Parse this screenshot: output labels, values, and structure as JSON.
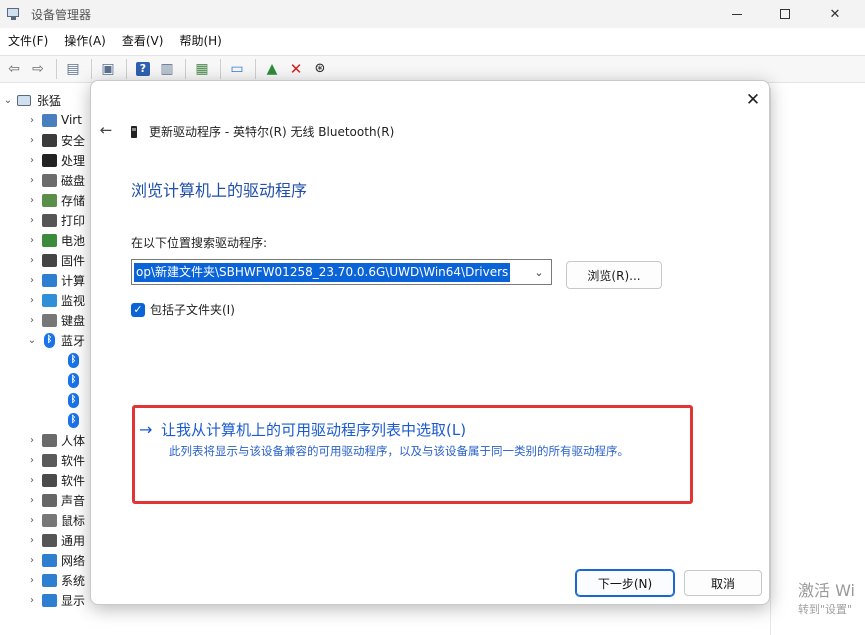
{
  "window": {
    "title": "设备管理器",
    "close_glyph": "✕"
  },
  "menu": [
    "文件(F)",
    "操作(A)",
    "查看(V)",
    "帮助(H)"
  ],
  "tree": {
    "root": "张猛",
    "items": [
      {
        "label": "Virt",
        "icon_color": "#4a7fbf"
      },
      {
        "label": "安全",
        "icon_color": "#3b3b3b"
      },
      {
        "label": "处理",
        "icon_color": "#222222"
      },
      {
        "label": "磁盘",
        "icon_color": "#6b6b6b"
      },
      {
        "label": "存储",
        "icon_color": "#5a8f4a"
      },
      {
        "label": "打印",
        "icon_color": "#555555"
      },
      {
        "label": "电池",
        "icon_color": "#3c8a3c"
      },
      {
        "label": "固件",
        "icon_color": "#444444"
      },
      {
        "label": "计算",
        "icon_color": "#2f7fd0"
      },
      {
        "label": "监视",
        "icon_color": "#2f90d8"
      },
      {
        "label": "键盘",
        "icon_color": "#777777"
      },
      {
        "label": "蓝牙",
        "icon_color": "#1a73e8"
      },
      {
        "label": "人体",
        "icon_color": "#6a6a6a"
      },
      {
        "label": "软件",
        "icon_color": "#5a5a5a"
      },
      {
        "label": "软件",
        "icon_color": "#4a4a4a"
      },
      {
        "label": "声音",
        "icon_color": "#666666"
      },
      {
        "label": "鼠标",
        "icon_color": "#777777"
      },
      {
        "label": "通用",
        "icon_color": "#555555"
      },
      {
        "label": "网络",
        "icon_color": "#2f7fd0"
      },
      {
        "label": "系统",
        "icon_color": "#2f7fd0"
      },
      {
        "label": "显示",
        "icon_color": "#2f7fd0"
      }
    ]
  },
  "dialog": {
    "close_glyph": "✕",
    "back_glyph": "←",
    "header": "更新驱动程序 - 英特尔(R) 无线 Bluetooth(R)",
    "heading": "浏览计算机上的驱动程序",
    "search_label": "在以下位置搜索驱动程序:",
    "path_value": "op\\新建文件夹\\SBHWFW01258_23.70.0.6G\\UWD\\Win64\\Drivers",
    "browse_label": "浏览(R)...",
    "include_subfolders": "包括子文件夹(I)",
    "pick_arrow": "→",
    "pick_title": "让我从计算机上的可用驱动程序列表中选取(L)",
    "pick_desc": "此列表将显示与该设备兼容的可用驱动程序，以及与该设备属于同一类别的所有驱动程序。",
    "next_label": "下一步(N)",
    "cancel_label": "取消",
    "accent_color": "#1a5bd0",
    "highlight_color": "#e13535"
  },
  "watermark": {
    "line1": "激活 Wi",
    "line2": "转到\"设置\""
  }
}
